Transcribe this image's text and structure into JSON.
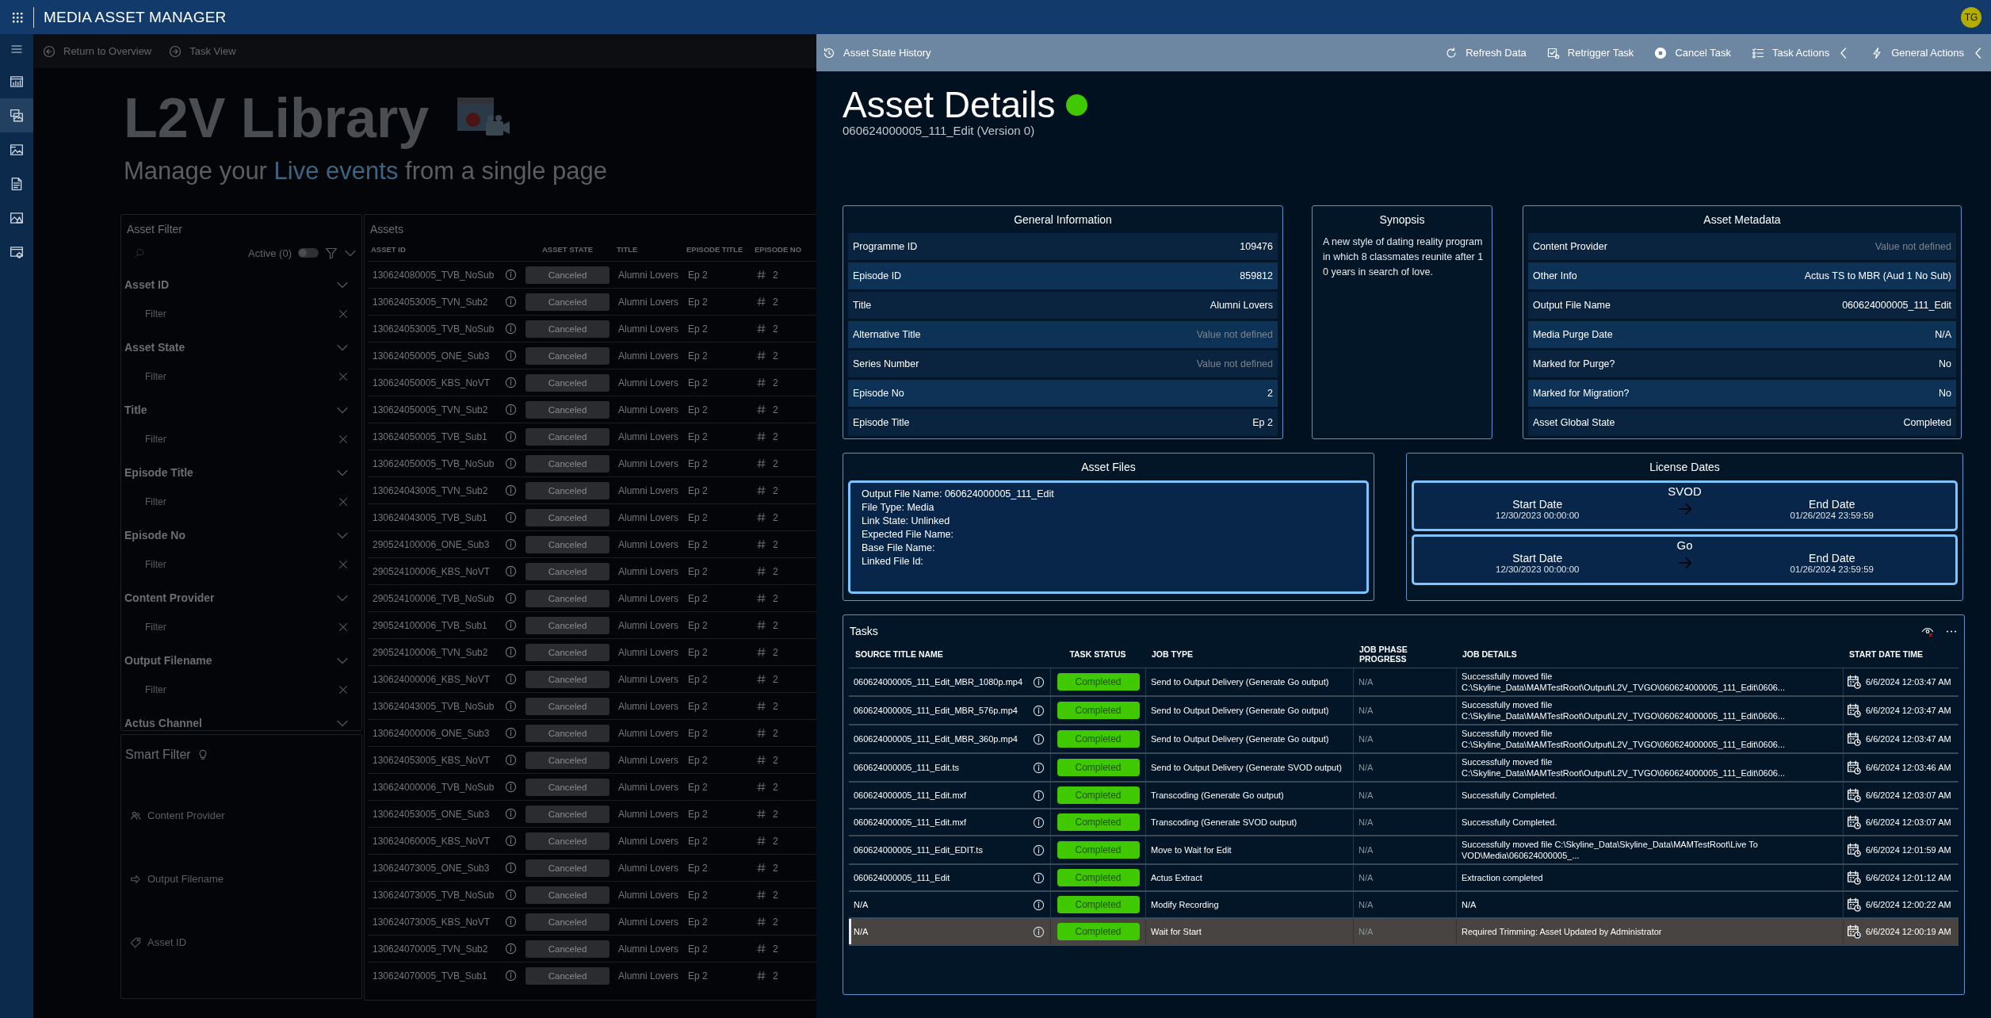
{
  "app": {
    "title": "MEDIA ASSET MANAGER",
    "user_initials": "TG"
  },
  "nav_rail": {
    "items": [
      {
        "kind": "chart",
        "selected": false
      },
      {
        "kind": "library",
        "selected": true
      },
      {
        "kind": "gallery",
        "selected": false
      },
      {
        "kind": "document",
        "selected": false
      },
      {
        "kind": "image-alert",
        "selected": false
      },
      {
        "kind": "settings",
        "selected": false
      }
    ]
  },
  "breadcrumb": [
    {
      "kind": "back",
      "label": "Return to Overview"
    },
    {
      "kind": "forward",
      "label": "Task View"
    }
  ],
  "library": {
    "title": "L2V Library",
    "subtitle": [
      {
        "text": "Manage your",
        "highlight": false
      },
      {
        "text": "Live events",
        "highlight": true
      },
      {
        "text": "from a single page",
        "highlight": false
      }
    ]
  },
  "asset_filter": {
    "title": "Asset Filter",
    "active_label": "Active (0)",
    "active_on": false,
    "sections": [
      {
        "label": "Asset ID",
        "placeholder": "Filter"
      },
      {
        "label": "Asset State",
        "placeholder": "Filter"
      },
      {
        "label": "Title",
        "placeholder": "Filter"
      },
      {
        "label": "Episode Title",
        "placeholder": "Filter"
      },
      {
        "label": "Episode No",
        "placeholder": "Filter"
      },
      {
        "label": "Content Provider",
        "placeholder": "Filter"
      },
      {
        "label": "Output Filename",
        "placeholder": "Filter"
      },
      {
        "label": "Actus Channel"
      }
    ]
  },
  "smart_filter": {
    "title": "Smart Filter",
    "items": [
      {
        "kind": "people",
        "label": "Content Provider"
      },
      {
        "kind": "arrow",
        "label": "Output Filename"
      },
      {
        "kind": "tag",
        "label": "Asset ID"
      }
    ]
  },
  "assets": {
    "title": "Assets",
    "columns": [
      "ASSET ID",
      "ASSET STATE",
      "TITLE",
      "EPISODE TITLE",
      "EPISODE NO"
    ],
    "rows": [
      {
        "asset_id": "130624080005_TVB_NoSub",
        "state": "Canceled",
        "title": "Alumni Lovers",
        "episode_title": "Ep 2",
        "episode_no": "2"
      },
      {
        "asset_id": "130624053005_TVN_Sub2",
        "state": "Canceled",
        "title": "Alumni Lovers",
        "episode_title": "Ep 2",
        "episode_no": "2"
      },
      {
        "asset_id": "130624053005_TVB_NoSub",
        "state": "Canceled",
        "title": "Alumni Lovers",
        "episode_title": "Ep 2",
        "episode_no": "2"
      },
      {
        "asset_id": "130624050005_ONE_Sub3",
        "state": "Canceled",
        "title": "Alumni Lovers",
        "episode_title": "Ep 2",
        "episode_no": "2"
      },
      {
        "asset_id": "130624050005_KBS_NoVT",
        "state": "Canceled",
        "title": "Alumni Lovers",
        "episode_title": "Ep 2",
        "episode_no": "2"
      },
      {
        "asset_id": "130624050005_TVN_Sub2",
        "state": "Canceled",
        "title": "Alumni Lovers",
        "episode_title": "Ep 2",
        "episode_no": "2"
      },
      {
        "asset_id": "130624050005_TVB_Sub1",
        "state": "Canceled",
        "title": "Alumni Lovers",
        "episode_title": "Ep 2",
        "episode_no": "2"
      },
      {
        "asset_id": "130624050005_TVB_NoSub",
        "state": "Canceled",
        "title": "Alumni Lovers",
        "episode_title": "Ep 2",
        "episode_no": "2"
      },
      {
        "asset_id": "130624043005_TVN_Sub2",
        "state": "Canceled",
        "title": "Alumni Lovers",
        "episode_title": "Ep 2",
        "episode_no": "2"
      },
      {
        "asset_id": "130624043005_TVB_Sub1",
        "state": "Canceled",
        "title": "Alumni Lovers",
        "episode_title": "Ep 2",
        "episode_no": "2"
      },
      {
        "asset_id": "290524100006_ONE_Sub3",
        "state": "Canceled",
        "title": "Alumni Lovers",
        "episode_title": "Ep 2",
        "episode_no": "2"
      },
      {
        "asset_id": "290524100006_KBS_NoVT",
        "state": "Canceled",
        "title": "Alumni Lovers",
        "episode_title": "Ep 2",
        "episode_no": "2"
      },
      {
        "asset_id": "290524100006_TVB_NoSub",
        "state": "Canceled",
        "title": "Alumni Lovers",
        "episode_title": "Ep 2",
        "episode_no": "2"
      },
      {
        "asset_id": "290524100006_TVB_Sub1",
        "state": "Canceled",
        "title": "Alumni Lovers",
        "episode_title": "Ep 2",
        "episode_no": "2"
      },
      {
        "asset_id": "290524100006_TVN_Sub2",
        "state": "Canceled",
        "title": "Alumni Lovers",
        "episode_title": "Ep 2",
        "episode_no": "2"
      },
      {
        "asset_id": "130624000006_KBS_NoVT",
        "state": "Canceled",
        "title": "Alumni Lovers",
        "episode_title": "Ep 2",
        "episode_no": "2"
      },
      {
        "asset_id": "130624043005_TVB_NoSub",
        "state": "Canceled",
        "title": "Alumni Lovers",
        "episode_title": "Ep 2",
        "episode_no": "2"
      },
      {
        "asset_id": "130624000006_ONE_Sub3",
        "state": "Canceled",
        "title": "Alumni Lovers",
        "episode_title": "Ep 2",
        "episode_no": "2"
      },
      {
        "asset_id": "130624053005_KBS_NoVT",
        "state": "Canceled",
        "title": "Alumni Lovers",
        "episode_title": "Ep 2",
        "episode_no": "2"
      },
      {
        "asset_id": "130624000006_TVB_NoSub",
        "state": "Canceled",
        "title": "Alumni Lovers",
        "episode_title": "Ep 2",
        "episode_no": "2"
      },
      {
        "asset_id": "130624053005_ONE_Sub3",
        "state": "Canceled",
        "title": "Alumni Lovers",
        "episode_title": "Ep 2",
        "episode_no": "2"
      },
      {
        "asset_id": "130624060005_KBS_NoVT",
        "state": "Canceled",
        "title": "Alumni Lovers",
        "episode_title": "Ep 2",
        "episode_no": "2"
      },
      {
        "asset_id": "130624073005_ONE_Sub3",
        "state": "Canceled",
        "title": "Alumni Lovers",
        "episode_title": "Ep 2",
        "episode_no": "2"
      },
      {
        "asset_id": "130624073005_TVB_NoSub",
        "state": "Canceled",
        "title": "Alumni Lovers",
        "episode_title": "Ep 2",
        "episode_no": "2"
      },
      {
        "asset_id": "130624073005_KBS_NoVT",
        "state": "Canceled",
        "title": "Alumni Lovers",
        "episode_title": "Ep 2",
        "episode_no": "2"
      },
      {
        "asset_id": "130624070005_TVN_Sub2",
        "state": "Canceled",
        "title": "Alumni Lovers",
        "episode_title": "Ep 2",
        "episode_no": "2"
      },
      {
        "asset_id": "130624070005_TVB_Sub1",
        "state": "Canceled",
        "title": "Alumni Lovers",
        "episode_title": "Ep 2",
        "episode_no": "2"
      }
    ]
  },
  "detail": {
    "toolbar": {
      "history": "Asset State History",
      "actions": [
        {
          "kind": "refresh",
          "label": "Refresh Data",
          "menu": false
        },
        {
          "kind": "retrigger",
          "label": "Retrigger Task",
          "menu": false
        },
        {
          "kind": "cancel",
          "label": "Cancel Task",
          "menu": false
        },
        {
          "kind": "tasks",
          "label": "Task Actions",
          "menu": true
        },
        {
          "kind": "general",
          "label": "General Actions",
          "menu": true
        }
      ]
    },
    "title": "Asset Details",
    "subtitle": "060624000005_111_Edit (Version 0)",
    "general_information": {
      "title": "General Information",
      "rows": [
        {
          "label": "Programme ID",
          "value": "109476",
          "defined": true
        },
        {
          "label": "Episode ID",
          "value": "859812",
          "defined": true
        },
        {
          "label": "Title",
          "value": "Alumni Lovers",
          "defined": true
        },
        {
          "label": "Alternative Title",
          "value": "Value not defined",
          "defined": false
        },
        {
          "label": "Series Number",
          "value": "Value not defined",
          "defined": false
        },
        {
          "label": "Episode No",
          "value": "2",
          "defined": true
        },
        {
          "label": "Episode Title",
          "value": "Ep 2",
          "defined": true
        }
      ]
    },
    "synopsis": {
      "title": "Synopsis",
      "text": "A new style of dating reality program in which 8 classmates reunite after 10 years in search of love."
    },
    "asset_metadata": {
      "title": "Asset Metadata",
      "rows": [
        {
          "label": "Content Provider",
          "value": "Value not defined",
          "defined": false
        },
        {
          "label": "Other Info",
          "value": "Actus TS to MBR (Aud 1 No Sub)",
          "defined": true
        },
        {
          "label": "Output File Name",
          "value": "060624000005_111_Edit",
          "defined": true
        },
        {
          "label": "Media Purge Date",
          "value": "N/A",
          "defined": true
        },
        {
          "label": "Marked for Purge?",
          "value": "No",
          "defined": true
        },
        {
          "label": "Marked for Migration?",
          "value": "No",
          "defined": true
        },
        {
          "label": "Asset Global State",
          "value": "Completed",
          "defined": true
        }
      ]
    },
    "asset_files": {
      "title": "Asset Files",
      "lines": [
        "Output File Name: 060624000005_111_Edit",
        "File Type: Media",
        "Link State: Unlinked",
        "Expected File Name:",
        "Base File Name:",
        "Linked File Id:"
      ]
    },
    "license_dates": {
      "title": "License Dates",
      "windows": [
        {
          "name": "SVOD",
          "start_label": "Start Date",
          "start": "12/30/2023 00:00:00",
          "end_label": "End Date",
          "end": "01/26/2024 23:59:59"
        },
        {
          "name": "Go",
          "start_label": "Start Date",
          "start": "12/30/2023 00:00:00",
          "end_label": "End Date",
          "end": "01/26/2024 23:59:59"
        }
      ]
    },
    "tasks": {
      "title": "Tasks",
      "columns": [
        "SOURCE TITLE NAME",
        "TASK STATUS",
        "JOB TYPE",
        "JOB PHASE PROGRESS",
        "JOB DETAILS",
        "START DATE TIME"
      ],
      "rows": [
        {
          "source": "060624000005_111_Edit_MBR_1080p.mp4",
          "status": "Completed",
          "job_type": "Send to Output Delivery (Generate Go output)",
          "progress": "N/A",
          "details": "Successfully moved file C:\\Skyline_Data\\MAMTestRoot\\Output\\L2V_TVGO\\060624000005_111_Edit\\0606...",
          "start": "6/6/2024 12:03:47 AM",
          "selected": false
        },
        {
          "source": "060624000005_111_Edit_MBR_576p.mp4",
          "status": "Completed",
          "job_type": "Send to Output Delivery (Generate Go output)",
          "progress": "N/A",
          "details": "Successfully moved file C:\\Skyline_Data\\MAMTestRoot\\Output\\L2V_TVGO\\060624000005_111_Edit\\0606...",
          "start": "6/6/2024 12:03:47 AM",
          "selected": false
        },
        {
          "source": "060624000005_111_Edit_MBR_360p.mp4",
          "status": "Completed",
          "job_type": "Send to Output Delivery (Generate Go output)",
          "progress": "N/A",
          "details": "Successfully moved file C:\\Skyline_Data\\MAMTestRoot\\Output\\L2V_TVGO\\060624000005_111_Edit\\0606...",
          "start": "6/6/2024 12:03:47 AM",
          "selected": false
        },
        {
          "source": "060624000005_111_Edit.ts",
          "status": "Completed",
          "job_type": "Send to Output Delivery (Generate SVOD output)",
          "progress": "N/A",
          "details": "Successfully moved file C:\\Skyline_Data\\MAMTestRoot\\Output\\L2V_TVGO\\060624000005_111_Edit\\0606...",
          "start": "6/6/2024 12:03:46 AM",
          "selected": false
        },
        {
          "source": "060624000005_111_Edit.mxf",
          "status": "Completed",
          "job_type": "Transcoding (Generate Go output)",
          "progress": "N/A",
          "details": "Successfully Completed.",
          "start": "6/6/2024 12:03:07 AM",
          "selected": false
        },
        {
          "source": "060624000005_111_Edit.mxf",
          "status": "Completed",
          "job_type": "Transcoding (Generate SVOD output)",
          "progress": "N/A",
          "details": "Successfully Completed.",
          "start": "6/6/2024 12:03:07 AM",
          "selected": false
        },
        {
          "source": "060624000005_111_Edit_EDIT.ts",
          "status": "Completed",
          "job_type": "Move to Wait for Edit",
          "progress": "N/A",
          "details": "Successfully moved file C:\\Skyline_Data\\Skyline_Data\\MAMTestRoot\\Live To VOD\\Media\\060624000005_...",
          "start": "6/6/2024 12:01:59 AM",
          "selected": false
        },
        {
          "source": "060624000005_111_Edit",
          "status": "Completed",
          "job_type": "Actus Extract",
          "progress": "N/A",
          "details": "Extraction completed",
          "start": "6/6/2024 12:01:12 AM",
          "selected": false
        },
        {
          "source": "N/A",
          "status": "Completed",
          "job_type": "Modify Recording",
          "progress": "N/A",
          "details": "N/A",
          "start": "6/6/2024 12:00:22 AM",
          "selected": false
        },
        {
          "source": "N/A",
          "status": "Completed",
          "job_type": "Wait for Start",
          "progress": "N/A",
          "details": "Required Trimming: Asset Updated by Administrator",
          "start": "6/6/2024 12:00:19 AM",
          "selected": true
        }
      ]
    }
  }
}
